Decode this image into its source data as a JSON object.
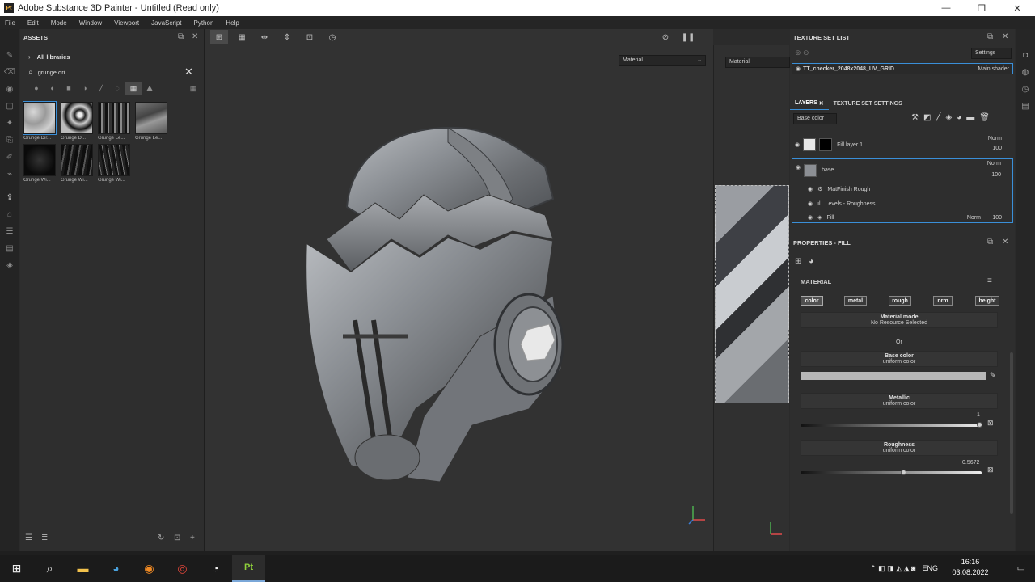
{
  "window": {
    "title": "Adobe Substance 3D Painter - Untitled (Read only)",
    "app_icon": "Pt",
    "controls": [
      "—",
      "❐",
      "✕"
    ]
  },
  "menu": [
    "File",
    "Edit",
    "Mode",
    "Window",
    "Viewport",
    "JavaScript",
    "Python",
    "Help"
  ],
  "assets": {
    "title": "ASSETS",
    "library": "All libraries",
    "search_value": "grunge dri",
    "items": [
      {
        "name": "Grunge Dir..."
      },
      {
        "name": "Grunge D..."
      },
      {
        "name": "Grunge Le..."
      },
      {
        "name": "Grunge Le..."
      },
      {
        "name": "Grunge Wi..."
      },
      {
        "name": "Grunge Wi..."
      },
      {
        "name": "Grunge Wi..."
      }
    ]
  },
  "viewport": {
    "left_select": "Material",
    "right_select": "Material"
  },
  "texture_set_list": {
    "title": "TEXTURE SET LIST",
    "settings_label": "Settings",
    "set_name": "TT_checker_2048x2048_UV_GRID",
    "shader": "Main shader"
  },
  "layers": {
    "tab_layers": "LAYERS",
    "tab_settings": "TEXTURE SET SETTINGS",
    "channel": "Base color",
    "items": [
      {
        "name": "Fill layer 1",
        "blend": "Norm",
        "opacity": "100"
      },
      {
        "name": "base",
        "blend": "Norm",
        "opacity": "100"
      }
    ],
    "effects": [
      {
        "name": "MatFinish Rough"
      },
      {
        "name": "Levels - Roughness"
      },
      {
        "name": "Fill",
        "blend": "Norm",
        "opacity": "100"
      }
    ]
  },
  "properties": {
    "title": "PROPERTIES - FILL",
    "section": "MATERIAL",
    "chips": [
      "color",
      "metal",
      "rough",
      "nrm",
      "height"
    ],
    "material_mode_label": "Material mode",
    "material_mode_value": "No Resource Selected",
    "or_label": "Or",
    "base_color_label": "Base color",
    "base_color_mode": "uniform color",
    "metallic_label": "Metallic",
    "metallic_mode": "uniform color",
    "metallic_value": "1",
    "roughness_label": "Roughness",
    "roughness_mode": "uniform color",
    "roughness_value": "0.5672"
  },
  "taskbar": {
    "time": "16:16",
    "date": "03.08.2022",
    "lang": "ENG"
  },
  "colors": {
    "accent": "#3a8fd8",
    "panel": "#2e2e2e",
    "viewport": "#323232"
  }
}
